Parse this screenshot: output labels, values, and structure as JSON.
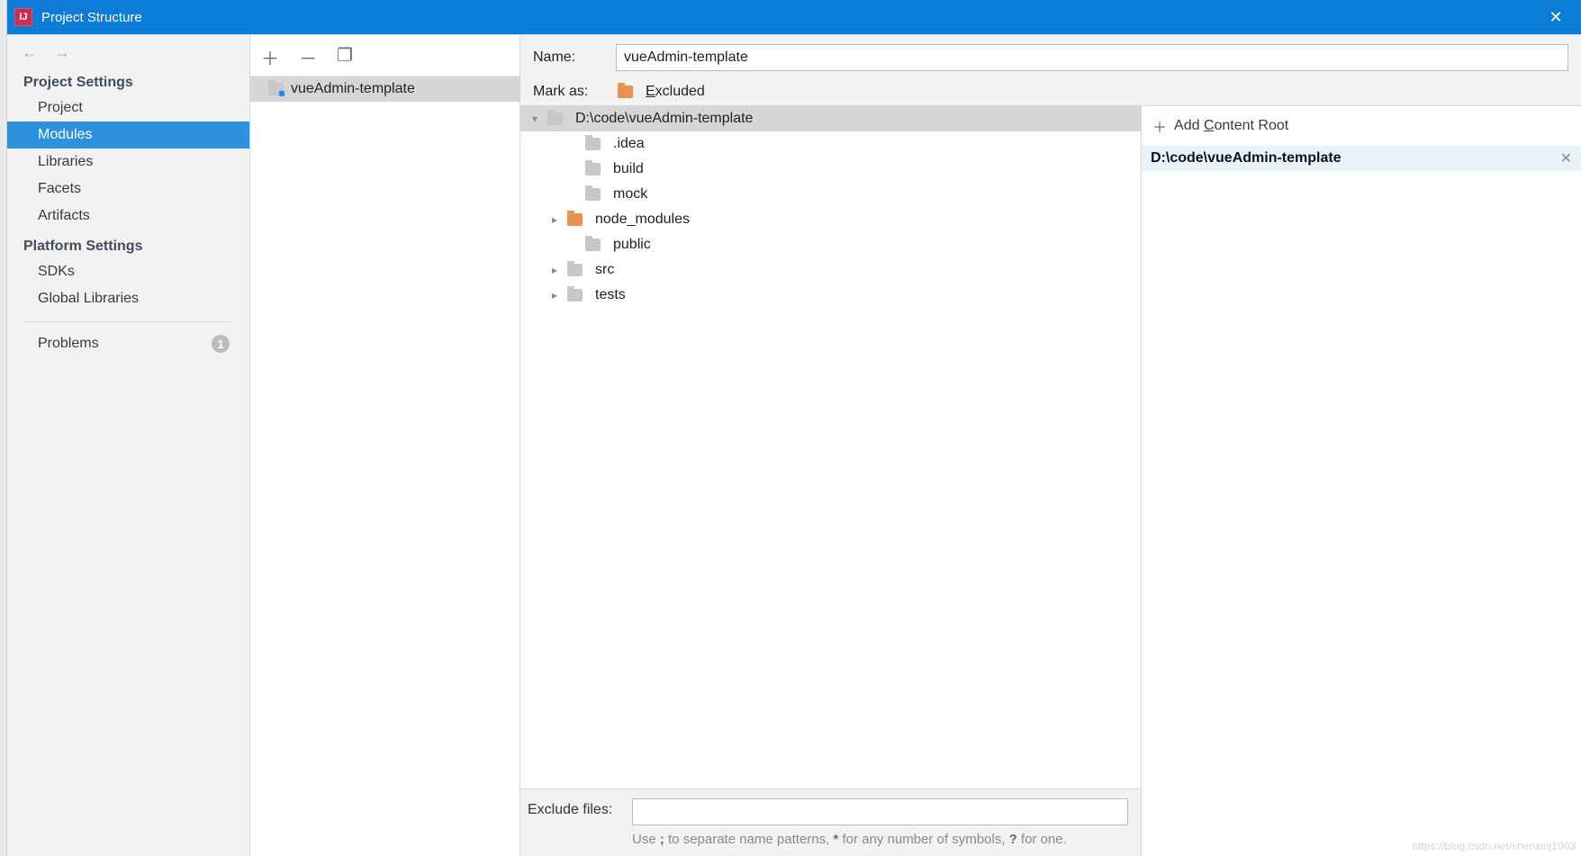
{
  "window": {
    "title": "Project Structure"
  },
  "nav": {
    "section1": "Project Settings",
    "items1": [
      "Project",
      "Modules",
      "Libraries",
      "Facets",
      "Artifacts"
    ],
    "section2": "Platform Settings",
    "items2": [
      "SDKs",
      "Global Libraries"
    ],
    "problems_label": "Problems",
    "problems_count": "1",
    "selected_index": 1
  },
  "modules": {
    "items": [
      {
        "name": "vueAdmin-template"
      }
    ]
  },
  "detail": {
    "name_label": "Name:",
    "name_value": "vueAdmin-template",
    "mark_as_label": "Mark as:",
    "mark_excluded_prefix": "E",
    "mark_excluded_rest": "xcluded"
  },
  "tree": {
    "root": "D:\\code\\vueAdmin-template",
    "children": [
      {
        "name": ".idea",
        "expandable": false,
        "orange": false
      },
      {
        "name": "build",
        "expandable": false,
        "orange": false
      },
      {
        "name": "mock",
        "expandable": false,
        "orange": false
      },
      {
        "name": "node_modules",
        "expandable": true,
        "orange": true
      },
      {
        "name": "public",
        "expandable": false,
        "orange": false
      },
      {
        "name": "src",
        "expandable": true,
        "orange": false
      },
      {
        "name": "tests",
        "expandable": true,
        "orange": false
      }
    ]
  },
  "exclude": {
    "label": "Exclude files:",
    "value": "",
    "hint_pre": "Use ",
    "hint_semi": ";",
    "hint_mid1": " to separate name patterns, ",
    "hint_star": "*",
    "hint_mid2": " for any number of symbols, ",
    "hint_q": "?",
    "hint_post": " for one."
  },
  "roots": {
    "add_label_prefix": "Add ",
    "add_label_u": "C",
    "add_label_rest": "ontent Root",
    "entries": [
      "D:\\code\\vueAdmin-template"
    ]
  },
  "watermark": "https://blog.csdn.net/shenxinj1003"
}
